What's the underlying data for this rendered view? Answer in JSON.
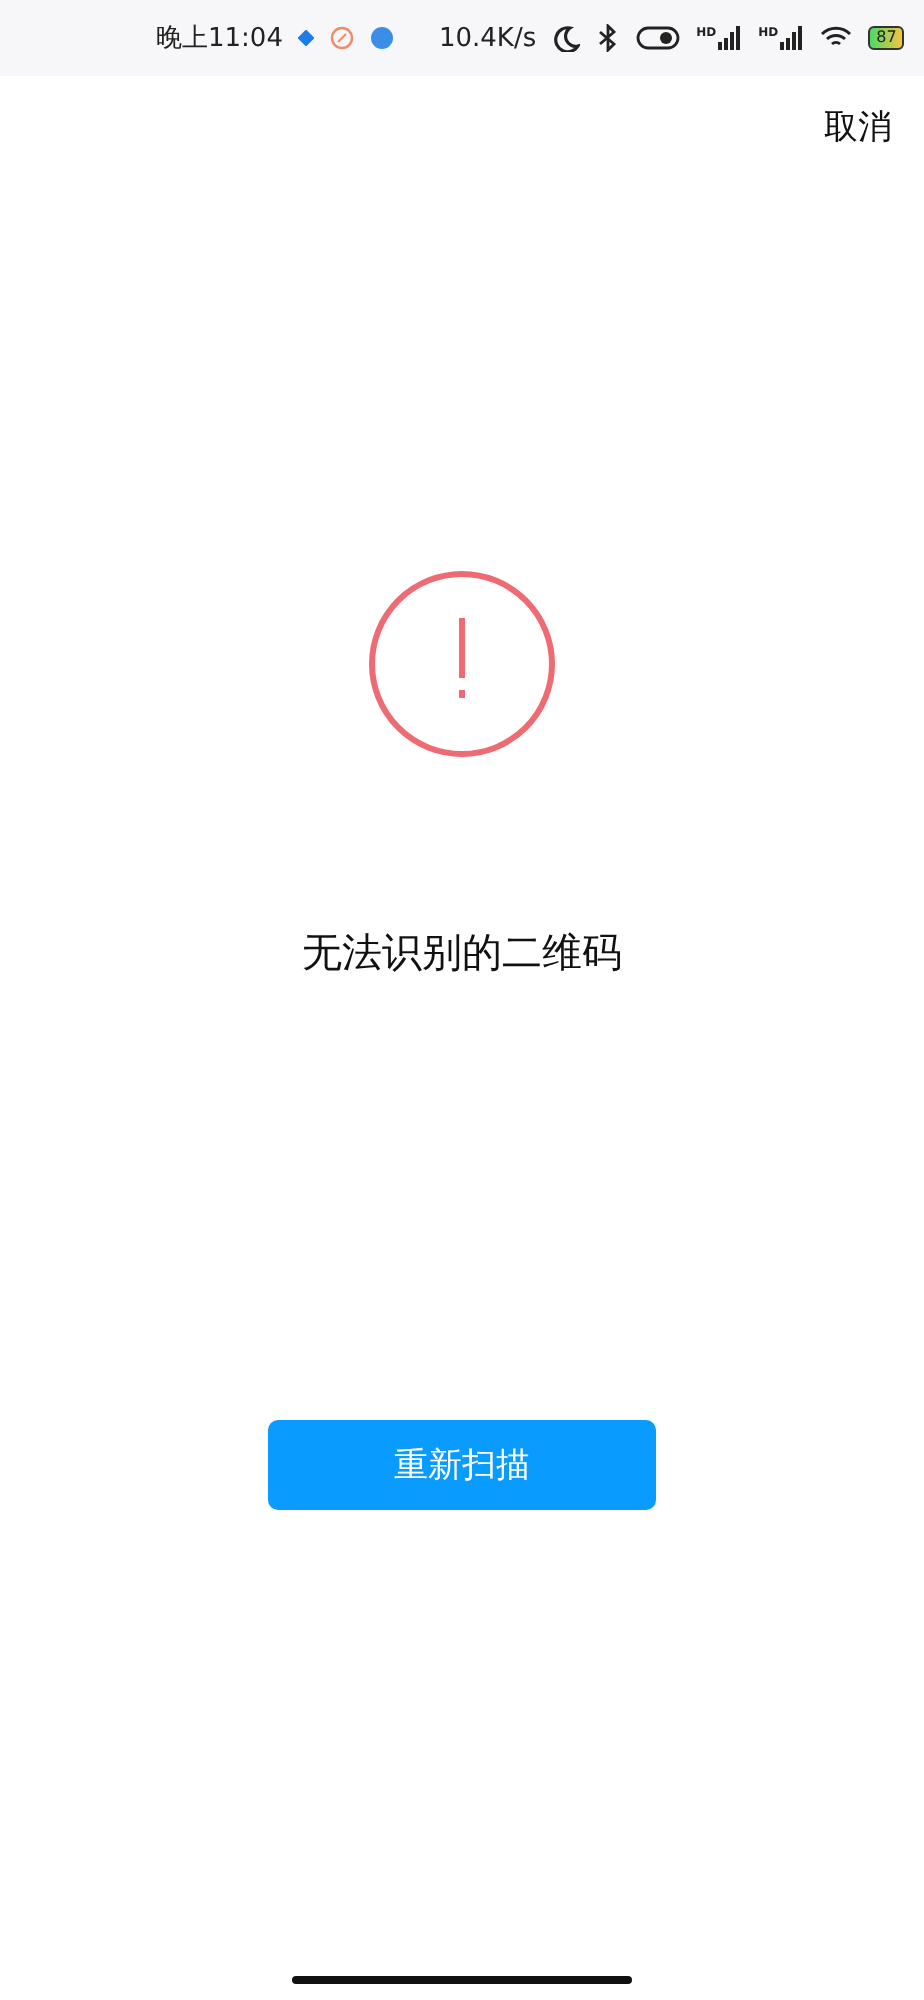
{
  "status_bar": {
    "time": "晚上11:04",
    "speed": "10.4K/s",
    "signal_labels": [
      "HD",
      "HD"
    ],
    "battery": "87"
  },
  "cancel": "取消",
  "message": "无法识别的二维码",
  "button": "重新扫描"
}
